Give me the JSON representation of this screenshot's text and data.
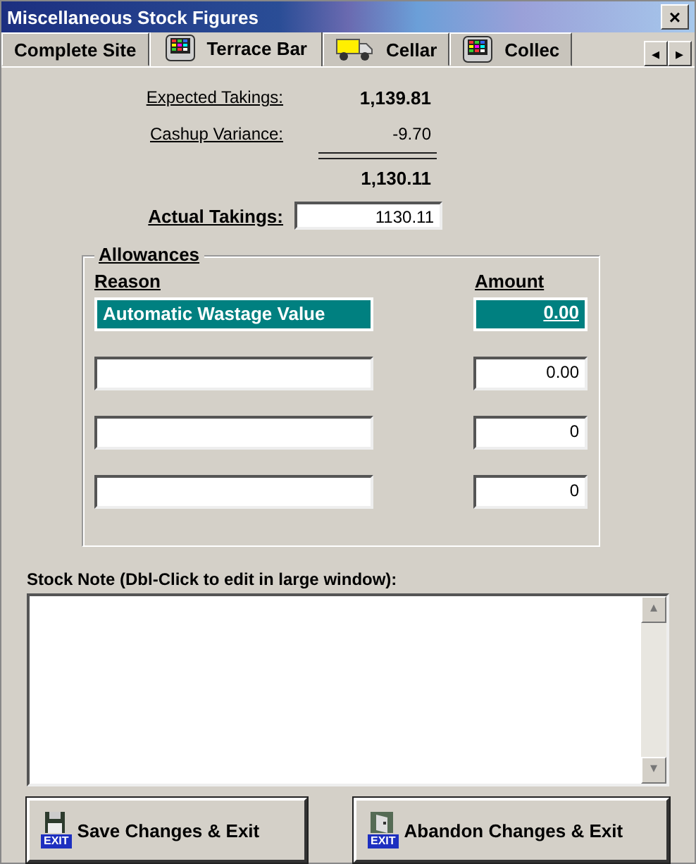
{
  "window": {
    "title": "Miscellaneous Stock Figures",
    "close": "×"
  },
  "tabs": [
    {
      "label": "Complete Site",
      "kind": "plain",
      "selected": false
    },
    {
      "label": "Terrace Bar",
      "kind": "till",
      "selected": true
    },
    {
      "label": "Cellar",
      "kind": "truck",
      "selected": false
    },
    {
      "label": "Collec",
      "kind": "till",
      "selected": false
    }
  ],
  "tab_scroll": [
    "◂",
    "▸"
  ],
  "summary": {
    "expected_label": "Expected Takings:",
    "expected_value": "1,139.81",
    "variance_label": "Cashup Variance:",
    "variance_value": "-9.70",
    "total": "1,130.11",
    "actual_label": "Actual Takings:",
    "actual_value": "1130.11"
  },
  "allowances": {
    "title": "Allowances",
    "reason_heading": "Reason",
    "amount_heading": "Amount",
    "rows": [
      {
        "reason": "Automatic Wastage Value",
        "amount": "0.00",
        "selected": true
      },
      {
        "reason": "",
        "amount": "0.00",
        "selected": false
      },
      {
        "reason": "",
        "amount": "0",
        "selected": false
      },
      {
        "reason": "",
        "amount": "0",
        "selected": false
      }
    ]
  },
  "stock_note": {
    "label": "Stock Note (Dbl-Click to edit in large window):",
    "scroll": [
      "▴",
      "▾"
    ]
  },
  "buttons": [
    {
      "label": "Save Changes & Exit",
      "kind": "save",
      "badge": "EXIT"
    },
    {
      "label": "Abandon Changes & Exit",
      "kind": "abandon",
      "badge": "EXIT"
    }
  ]
}
